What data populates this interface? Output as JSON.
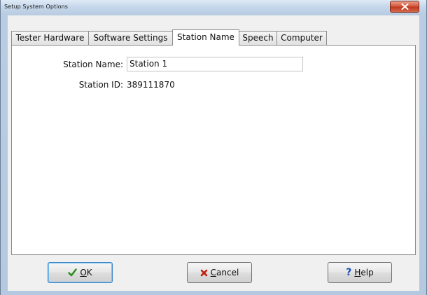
{
  "window": {
    "title": "Setup System Options"
  },
  "tabs": [
    {
      "label": "Tester Hardware"
    },
    {
      "label": "Software Settings"
    },
    {
      "label": "Station Name"
    },
    {
      "label": "Speech"
    },
    {
      "label": "Computer"
    }
  ],
  "active_tab": "Station Name",
  "form": {
    "station_name_label": "Station Name:",
    "station_name_value": "Station 1",
    "station_id_label": "Station ID:",
    "station_id_value": "389111870"
  },
  "buttons": {
    "ok": {
      "prefix": "",
      "accel": "O",
      "rest": "K",
      "icon": "checkmark-icon"
    },
    "cancel": {
      "prefix": "",
      "accel": "C",
      "rest": "ancel",
      "icon": "x-icon"
    },
    "help": {
      "prefix": "",
      "accel": "H",
      "rest": "elp",
      "icon": "question-mark-icon"
    }
  },
  "colors": {
    "ok_icon": "#2c8a1e",
    "cancel_icon": "#c21d0f",
    "help_icon": "#1a4fb5",
    "close_button": "#c9472b"
  }
}
